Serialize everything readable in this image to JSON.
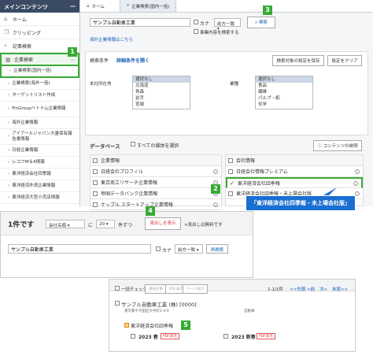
{
  "sidebar": {
    "header": "メインコンテンツ",
    "collapse": "—",
    "items": [
      {
        "icon": "⌂",
        "label": "ホーム"
      },
      {
        "icon": "❐",
        "label": "クリッピング"
      },
      {
        "icon": "⌕",
        "label": "記事検索"
      },
      {
        "icon": "▦",
        "label": "企業検索",
        "extra": "…"
      }
    ],
    "subitems": [
      "企業検索(国内一括)",
      "企業検索(海外一括)",
      "ターゲットリスト作成",
      "FinGroupベトナム企業情報",
      "海外企業情報",
      "アイアールジャパン大量保有報告書情報",
      "日経企業情報",
      "レコフM＆A情報",
      "東洋経済会社四季報",
      "東洋経済外資企業情報",
      "東洋経済大型小売店情報"
    ]
  },
  "tabs": {
    "home": "ホーム",
    "active": "企業検索(国内一括)"
  },
  "search": {
    "query": "サンプル自動車工業",
    "kana_label": "カナ",
    "match_mode": "前方一致",
    "fulltext_label": "事業内容を検索する",
    "button": "検索",
    "overseas_link": "海外企業情報はこちら"
  },
  "conditions": {
    "label": "検索条件",
    "detail_link": "詳細条件を開く",
    "save_button": "検索対象の設定を保存",
    "reset_button": "設定をクリア",
    "hq_label": "本社所在地",
    "hq_options": [
      "選択なし",
      "北海道",
      "青森",
      "岩手",
      "宮城"
    ],
    "industry_label": "業種",
    "industry_options": [
      "選択なし",
      "食品",
      "繊維",
      "パルプ・紙",
      "化学"
    ]
  },
  "database": {
    "label": "データベース",
    "all_label": "すべての媒体を選択",
    "contents_button": "コンテンツの説明",
    "left_header": "企業情報",
    "left_rows": [
      "日経会社プロフィル",
      "東京商工リサーチ企業情報",
      "帝国データバンク企業情報",
      "ケップル スタートアップ企業情報"
    ],
    "right_header": "会社情報",
    "right_rows": [
      "日経会社情報プレミアム",
      "東洋経済会社四季報",
      "東洋経済会社四季報・未上場会社版"
    ]
  },
  "callout": "「東洋経済会社四季報・未上場会社版」",
  "results": {
    "count": "1件です",
    "sort": "会社名順",
    "order_sep": "に",
    "per_page": "20",
    "per_page_suffix": "件ずつ",
    "show_button": "見出しを表示",
    "note": "×見出しは無料です",
    "query": "サンプル自動車工業",
    "kana_label": "カナ",
    "match_mode": "前方一致",
    "research_button": "再検索"
  },
  "detail": {
    "select_all": "一括チェック",
    "disabled_buttons": [
      "選択記事",
      "PDF表示",
      "ページ表示"
    ],
    "pagination": "1-1/1件",
    "prev": "<<先頭",
    "prev2": "<前",
    "next": "次>",
    "last": "末尾>>",
    "company": "サンプル自動車工業 (株) [0000]",
    "address": "東京都千代田区大手町1-X-X",
    "industry": "自動車",
    "source": "東洋経済会社四季報",
    "issue1": "2023 春",
    "issue2": "2023 新春",
    "pdf": "PDF表示"
  },
  "markers": [
    "1",
    "2",
    "3",
    "4",
    "5"
  ]
}
